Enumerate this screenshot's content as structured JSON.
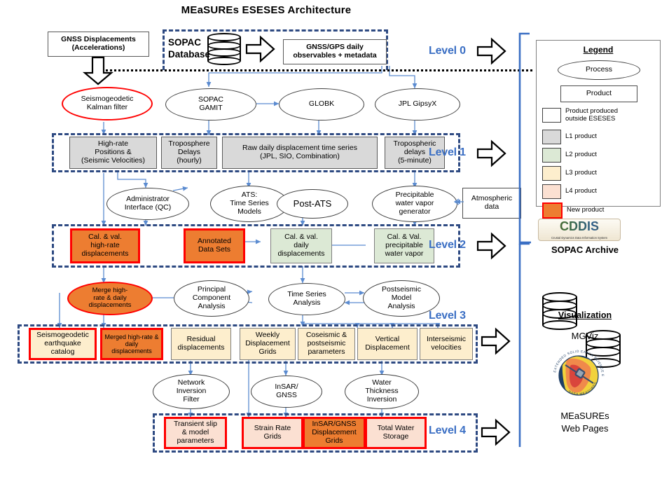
{
  "title": "MEaSUREs ESESES Architecture",
  "levels": [
    {
      "key": "level0",
      "label": "Level 0"
    },
    {
      "key": "level1",
      "label": "Level 1"
    },
    {
      "key": "level2",
      "label": "Level 2"
    },
    {
      "key": "level3",
      "label": "Level 3"
    },
    {
      "key": "level4",
      "label": "Level 4"
    }
  ],
  "level0": {
    "external_input": "GNSS Displacements\n(Accelerations)",
    "external_input_line1": "GNSS Displacements",
    "external_input_line2": "(Accelerations)",
    "sopac_db_line1": "SOPAC",
    "sopac_db_line2": "Database",
    "product_line1": "GNSS/GPS daily",
    "product_line2": "observables + metadata"
  },
  "processes_row1": [
    {
      "name": "seismogeodetic-kalman-filter",
      "line1": "Seismogeodetic",
      "line2": "Kalman filter",
      "style": "new-outline"
    },
    {
      "name": "sopac-gamit",
      "line1": "SOPAC",
      "line2": "GAMIT",
      "style": "plain"
    },
    {
      "name": "globk",
      "line1": "GLOBK",
      "line2": "",
      "style": "plain"
    },
    {
      "name": "jpl-gipsyx",
      "line1": "JPL GipsyX",
      "line2": "",
      "style": "plain"
    }
  ],
  "level1_products": [
    {
      "name": "high-rate-positions",
      "lines": [
        "High-rate",
        "Positions &",
        "(Seismic Velocities)"
      ],
      "cls": "l1"
    },
    {
      "name": "troposphere-delays-hourly",
      "lines": [
        "Troposphere",
        "Delays",
        "(hourly)"
      ],
      "cls": "l1"
    },
    {
      "name": "raw-daily-displacement-time-series",
      "lines": [
        "Raw daily displacement time series",
        "(JPL, SIO, Combination)"
      ],
      "cls": "l1"
    },
    {
      "name": "tropospheric-delays-5min",
      "lines": [
        "Tropospheric",
        "delays",
        "(5-minute)"
      ],
      "cls": "l1"
    }
  ],
  "processes_row2": [
    {
      "name": "administrator-interface-qc",
      "lines": [
        "Administrator",
        "Interface (QC)"
      ]
    },
    {
      "name": "ats-time-series-models",
      "lines": [
        "ATS:",
        "Time Series",
        "Models"
      ]
    },
    {
      "name": "post-ats",
      "lines": [
        "Post-ATS"
      ]
    },
    {
      "name": "precipitable-water-vapor-generator",
      "lines": [
        "Precipitable",
        "water vapor",
        "generator"
      ]
    }
  ],
  "atmospheric_data": {
    "lines": [
      "Atmospheric",
      "data"
    ]
  },
  "level2_products": [
    {
      "name": "cal-val-high-rate-displacements",
      "lines": [
        "Cal. & val.",
        "high-rate",
        "displacements"
      ],
      "cls": "new"
    },
    {
      "name": "annotated-data-sets",
      "lines": [
        "Annotated",
        "Data Sets"
      ],
      "cls": "new"
    },
    {
      "name": "cal-val-daily-displacements",
      "lines": [
        "Cal. & val.",
        "daily",
        "displacements"
      ],
      "cls": "l2"
    },
    {
      "name": "cal-val-precipitable-water-vapor",
      "lines": [
        "Cal. & Val.",
        "precipitable",
        "water vapor"
      ],
      "cls": "l2"
    }
  ],
  "processes_row3": [
    {
      "name": "merge-high-rate-daily-displacements",
      "lines": [
        "Merge high-",
        "rate & daily",
        "displacements"
      ],
      "style": "new"
    },
    {
      "name": "principal-component-analysis",
      "lines": [
        "Principal",
        "Component",
        "Analysis"
      ],
      "style": "plain"
    },
    {
      "name": "time-series-analysis",
      "lines": [
        "Time Series",
        "Analysis"
      ],
      "style": "plain"
    },
    {
      "name": "postseismic-model-analysis",
      "lines": [
        "Postseismic",
        "Model",
        "Analysis"
      ],
      "style": "plain"
    }
  ],
  "level3_products": [
    {
      "name": "seismogeodetic-earthquake-catalog",
      "lines": [
        "Seismogeodetic",
        "earthquake",
        "catalog"
      ],
      "cls": "l3 redge"
    },
    {
      "name": "merged-high-rate-daily-displacements",
      "lines": [
        "Merged high-rate &",
        "daily",
        "displacements"
      ],
      "cls": "new"
    },
    {
      "name": "residual-displacements",
      "lines": [
        "Residual",
        "displacements"
      ],
      "cls": "l3"
    },
    {
      "name": "weekly-displacement-grids",
      "lines": [
        "Weekly",
        "Displacement",
        "Grids"
      ],
      "cls": "l3"
    },
    {
      "name": "coseismic-postseismic-parameters",
      "lines": [
        "Coseismic &",
        "postseismic",
        "parameters"
      ],
      "cls": "l3"
    },
    {
      "name": "vertical-displacement",
      "lines": [
        "Vertical",
        "Displacement"
      ],
      "cls": "l3"
    },
    {
      "name": "interseismic-velocities",
      "lines": [
        "Interseismic",
        "velocities"
      ],
      "cls": "l3"
    }
  ],
  "processes_row4": [
    {
      "name": "network-inversion-filter",
      "lines": [
        "Network",
        "Inversion",
        "Filter"
      ]
    },
    {
      "name": "insar-gnss",
      "lines": [
        "InSAR/",
        "GNSS"
      ]
    },
    {
      "name": "water-thickness-inversion",
      "lines": [
        "Water",
        "Thickness",
        "Inversion"
      ]
    }
  ],
  "level4_products": [
    {
      "name": "transient-slip-model-parameters",
      "lines": [
        "Transient slip",
        "& model",
        "parameters"
      ],
      "cls": "l4 redge"
    },
    {
      "name": "strain-rate-grids",
      "lines": [
        "Strain Rate",
        "Grids"
      ],
      "cls": "l4 redge"
    },
    {
      "name": "insar-gnss-displacement-grids",
      "lines": [
        "InSAR/GNSS",
        "Displacement",
        "Grids"
      ],
      "cls": "new"
    },
    {
      "name": "total-water-storage",
      "lines": [
        "Total Water",
        "Storage"
      ],
      "cls": "l4 redge"
    }
  ],
  "legend": {
    "title": "Legend",
    "process_label": "Process",
    "product_label": "Product",
    "items": [
      {
        "name": "legend-outside",
        "color": "#ffffff",
        "border": "#404040",
        "line1": "Product produced",
        "line2": "outside ESESES"
      },
      {
        "name": "legend-l1",
        "color": "#d9d9d9",
        "border": "#404040",
        "line1": "L1 product",
        "line2": ""
      },
      {
        "name": "legend-l2",
        "color": "#dce9d5",
        "border": "#404040",
        "line1": "L2 product",
        "line2": ""
      },
      {
        "name": "legend-l3",
        "color": "#fdeecd",
        "border": "#404040",
        "line1": "L3 product",
        "line2": ""
      },
      {
        "name": "legend-l4",
        "color": "#fbe0d2",
        "border": "#404040",
        "line1": "L4 product",
        "line2": ""
      },
      {
        "name": "legend-new",
        "color": "#ed7d31",
        "border": "#ff0000",
        "line1": "New product",
        "line2": ""
      }
    ]
  },
  "right_column": {
    "cddis_logo_text": "CDDIS",
    "cddis_logo_subtitle": "Crustal Dynamics Data Information System",
    "sopac_archive": "SOPAC Archive",
    "visualization_heading": "Visualization",
    "mgviz": "MGViz",
    "measures_logo_ring_top": "EXTENDED SOLID EARTH SCIENCE ESDR SYSTEM",
    "measures_logo_ring_bottom": "NASA MEASURES",
    "web_pages_line1": "MEaSUREs",
    "web_pages_line2": "Web Pages"
  },
  "colors": {
    "level_label": "#3b6fc4",
    "dashed_border": "#2e4a82",
    "new_product_fill": "#ed7d31",
    "new_product_border": "#ff0000",
    "l1": "#d9d9d9",
    "l2": "#dce9d5",
    "l3": "#fdeecd",
    "l4": "#fbe0d2",
    "wire": "#5b8bd0"
  }
}
